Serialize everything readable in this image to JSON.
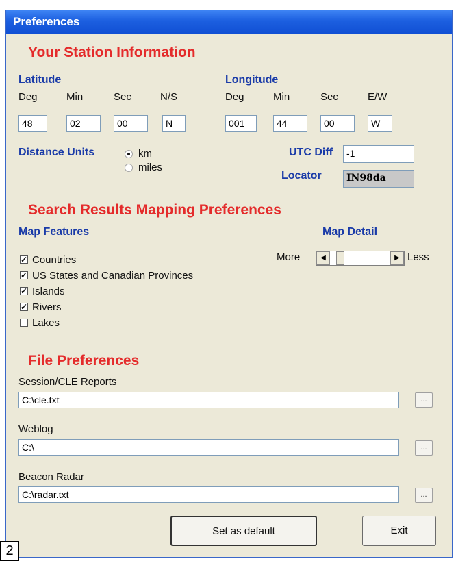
{
  "window": {
    "title": "Preferences"
  },
  "station": {
    "heading": "Your Station Information",
    "latitude": {
      "label": "Latitude",
      "deg_label": "Deg",
      "min_label": "Min",
      "sec_label": "Sec",
      "ns_label": "N/S",
      "deg": "48",
      "min": "02",
      "sec": "00",
      "ns": "N"
    },
    "longitude": {
      "label": "Longitude",
      "deg_label": "Deg",
      "min_label": "Min",
      "sec_label": "Sec",
      "ew_label": "E/W",
      "deg": "001",
      "min": "44",
      "sec": "00",
      "ew": "W"
    },
    "distance_units": {
      "label": "Distance Units",
      "options": [
        "km",
        "miles"
      ],
      "selected": "km"
    },
    "utc_diff": {
      "label": "UTC Diff",
      "value": "-1"
    },
    "locator": {
      "label": "Locator",
      "value": "IN98da"
    }
  },
  "mapping": {
    "heading": "Search Results Mapping Preferences",
    "features_label": "Map Features",
    "features": [
      {
        "label": "Countries",
        "checked": true
      },
      {
        "label": "US States and Canadian Provinces",
        "checked": true
      },
      {
        "label": "Islands",
        "checked": true
      },
      {
        "label": "Rivers",
        "checked": true
      },
      {
        "label": "Lakes",
        "checked": false
      }
    ],
    "detail": {
      "label": "Map Detail",
      "more_label": "More",
      "less_label": "Less",
      "level": 0.1
    }
  },
  "files": {
    "heading": "File Preferences",
    "session": {
      "label": "Session/CLE Reports",
      "value": "C:\\cle.txt"
    },
    "weblog": {
      "label": "Weblog",
      "value": "C:\\"
    },
    "beacon": {
      "label": "Beacon Radar",
      "value": "C:\\radar.txt"
    },
    "browse_label": "..."
  },
  "buttons": {
    "set_default": "Set as default",
    "exit": "Exit"
  },
  "figure_number": "2"
}
